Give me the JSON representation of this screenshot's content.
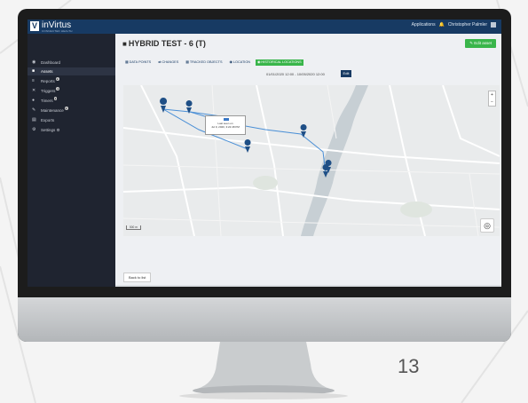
{
  "app": {
    "logo_letter": "V",
    "logo_name": "inVirtus",
    "logo_sub": "CONNECTED HEALTH",
    "top_links": [
      "Applications",
      "Christopher Palmler"
    ]
  },
  "sidebar": {
    "items": [
      {
        "icon": "gauge-icon",
        "glyph": "◉",
        "label": "Dashboard"
      },
      {
        "icon": "box-icon",
        "glyph": "■",
        "label": "Assets",
        "active": true
      },
      {
        "icon": "chart-icon",
        "glyph": "≡",
        "label": "Reports"
      },
      {
        "icon": "x-icon",
        "glyph": "✕",
        "label": "Triggers"
      },
      {
        "icon": "clock-icon",
        "glyph": "●",
        "label": "Timers"
      },
      {
        "icon": "wrench-icon",
        "glyph": "✎",
        "label": "Maintenance"
      },
      {
        "icon": "file-icon",
        "glyph": "▤",
        "label": "Exports"
      },
      {
        "icon": "gear-icon",
        "glyph": "⚙",
        "label": "Settings"
      }
    ]
  },
  "page": {
    "title": "HYBRID TEST - 6 (T)",
    "edit_asset": "Edit asset",
    "tabs": [
      "DATA POINTS",
      "CHANGES",
      "TRACKED OBJECTS",
      "LOCATION",
      "HISTORICAL LOCATIONS"
    ],
    "date_range": "01/01/2020 12:00 - 10/05/2020 12:00",
    "edit_label": "Edit",
    "popup_line1": "Last seen on",
    "popup_line2": "Jul 9, 2020, 3:22:48 PM",
    "scale_label": "500 m",
    "back": "Back to list"
  },
  "slide_number": "13",
  "colors": {
    "nav": "#173a63",
    "accent": "#39b54a",
    "pin": "#1f4f86",
    "track": "#4a8fd6"
  }
}
